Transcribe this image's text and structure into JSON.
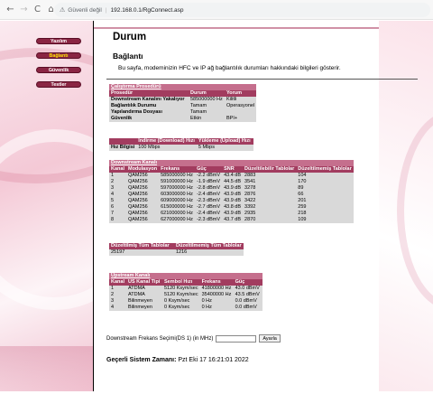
{
  "browser": {
    "back_glyph": "←",
    "forward_glyph": "→",
    "reload_glyph": "C",
    "home_glyph": "⌂",
    "security_label": "Güvenli değil",
    "url": "192.168.0.1/RgConnect.asp"
  },
  "menu": {
    "items": [
      "Yazılım",
      "Bağlantı",
      "Güvenlik",
      "Testler"
    ],
    "active_index": 1
  },
  "page": {
    "title": "Durum",
    "subtitle": "Bağlantı",
    "description": "Bu sayfa, modeminizin HFC ve IP ağ bağlantılık durumları hakkındaki bilgileri gösterir."
  },
  "startup": {
    "title": "Çalıştırma Prosedürü",
    "headers": [
      "Prosedür",
      "Durum",
      "Yorum"
    ],
    "rows": [
      [
        "Downstream Kanalını Yakalıyor",
        "585000000 Hz",
        "Kilitli"
      ],
      [
        "Bağlantılık Durumu",
        "Tamam",
        "Operasyonel"
      ],
      [
        "Yapılandırma Dosyası",
        "Tamam",
        ""
      ],
      [
        "Güvenlik",
        "Etkin",
        "BPI+"
      ]
    ]
  },
  "speed": {
    "headers": [
      "",
      "İndirme (Download) Hızı",
      "Yükleme (Upload) Hızı"
    ],
    "row": [
      "Hız Bilgisi",
      "100 Mbps",
      "5 Mbps"
    ]
  },
  "downstream": {
    "title": "Downstream Kanalı",
    "headers": [
      "Kanal",
      "Modulasyon",
      "Frekans",
      "Güç",
      "SNR",
      "Düzeltilebilir Tablolar",
      "Düzeltilmemiş Tablolar"
    ],
    "rows": [
      [
        "1",
        "QAM256",
        "585000000 Hz",
        "-2.2 dBmV",
        "43.4 dB",
        "2883",
        "104"
      ],
      [
        "2",
        "QAM256",
        "591000000 Hz",
        "-1.9 dBmV",
        "44.5 dB",
        "3541",
        "170"
      ],
      [
        "3",
        "QAM256",
        "597000000 Hz",
        "-2.8 dBmV",
        "43.9 dB",
        "3278",
        "89"
      ],
      [
        "4",
        "QAM256",
        "603000000 Hz",
        "-2.4 dBmV",
        "43.9 dB",
        "2876",
        "66"
      ],
      [
        "5",
        "QAM256",
        "609000000 Hz",
        "-2.3 dBmV",
        "43.9 dB",
        "3422",
        "201"
      ],
      [
        "6",
        "QAM256",
        "615000000 Hz",
        "-2.7 dBmV",
        "43.8 dB",
        "3392",
        "259"
      ],
      [
        "7",
        "QAM256",
        "621000000 Hz",
        "-2.4 dBmV",
        "43.9 dB",
        "2935",
        "218"
      ],
      [
        "8",
        "QAM256",
        "627000000 Hz",
        "-2.3 dBmV",
        "43.7 dB",
        "2870",
        "109"
      ]
    ]
  },
  "totals": {
    "headers": [
      "Düzeltilmiş Tüm Tablolar",
      "Düzeltilmemiş Tüm Tablolar"
    ],
    "row": [
      "25197",
      "1216"
    ]
  },
  "upstream": {
    "title": "Upstream Kanalı",
    "headers": [
      "Kanal",
      "US Kanal Tipi",
      "Sembol Hızı",
      "Frekans",
      "Güç"
    ],
    "rows": [
      [
        "1",
        "ATDMA",
        "5120 Ksym/sec",
        "41800000 Hz",
        "43.0 dBmV"
      ],
      [
        "2",
        "ATDMA",
        "5120 Ksym/sec",
        "35400000 Hz",
        "43.5 dBmV"
      ],
      [
        "3",
        "Bilinmeyen",
        "0 Ksym/sec",
        "0 Hz",
        "0.0 dBmV"
      ],
      [
        "4",
        "Bilinmeyen",
        "0 Ksym/sec",
        "0 Hz",
        "0.0 dBmV"
      ]
    ]
  },
  "freq_form": {
    "label": "Downstream Frekans Seçimi(DS 1) (in MHz)",
    "value": "",
    "button": "Ayarla"
  },
  "system_time": {
    "label": "Geçerli Sistem Zamanı:",
    "value": "Pzt Eki 17 16:21:01 2022"
  },
  "colors": {
    "header": "#a23c5f",
    "title_row": "#c56f8d",
    "data_row": "#d9d9d9",
    "menu_button": "#8a2543",
    "menu_active_text": "#ffe600"
  }
}
